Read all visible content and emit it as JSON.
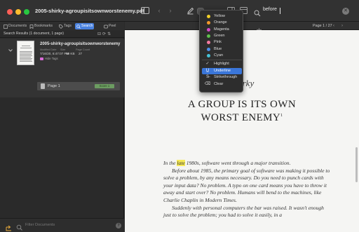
{
  "window": {
    "title": "2005-shirky-agroupisitsownworstenemy.pdf"
  },
  "search": {
    "value": "before"
  },
  "sidebar": {
    "tabs": [
      {
        "label": "Documents"
      },
      {
        "label": "Bookmarks"
      },
      {
        "label": "Tags"
      },
      {
        "label": "Search"
      },
      {
        "label": "Peel"
      }
    ],
    "results_summary": "Search Results (1 document, 1 page)",
    "result": {
      "title": "2005-shirky-agroupisitsownworstenemy",
      "meta_headers": [
        "Modified Date",
        "Size",
        "Page Count"
      ],
      "meta_values": [
        "7/16/20, 6:47:07 PM",
        "99 KB",
        "27"
      ],
      "tags": "Hide Tags",
      "page_label": "Page 1",
      "hit_badge": "Score 1"
    },
    "filter_placeholder": "Filter Documents"
  },
  "content": {
    "page_counter": "Page 1 / 27",
    "author": "Shirky",
    "title_line1": "A GROUP IS ITS OWN",
    "title_line2": "WORST ENEMY",
    "title_superscript": "1",
    "para1_prefix": "In the ",
    "para1_highlight": "late",
    "para1_rest": " 1980s, software went through a major transition.",
    "para2": "Before about 1985, the primary goal of software was making it possible to solve a problem, by any means necessary. Do you need to punch cards with your input data? No problem. A typo on one card means you have to throw it away and start over? No problem. Humans will bend to the machines, like Charlie Chaplin in Modern Times.",
    "para3": "Suddenly with personal computers the bar was raised. It wasn't enough just to solve the problem; you had to solve it easily, in a"
  },
  "annotation_menu": {
    "colors": [
      {
        "label": "Yellow",
        "color": "#f2d027"
      },
      {
        "label": "Orange",
        "color": "#f39a2a"
      },
      {
        "label": "Magenta",
        "color": "#d64ac8"
      },
      {
        "label": "Green",
        "color": "#5fbf4c"
      },
      {
        "label": "Pink",
        "color": "#f27aa0"
      },
      {
        "label": "Blue",
        "color": "#4d8fea"
      },
      {
        "label": "Cyan",
        "color": "#46c3d8"
      }
    ],
    "styles": [
      {
        "label": "Highlight",
        "checked": true
      },
      {
        "label": "Underline",
        "selected": true
      },
      {
        "label": "Strikethrough"
      },
      {
        "label": "Clear"
      }
    ]
  },
  "icons": {
    "sidebar_toggle": "sidebar-icon",
    "pen": "pen-icon",
    "search": "search-icon",
    "clear": "clear-icon"
  }
}
